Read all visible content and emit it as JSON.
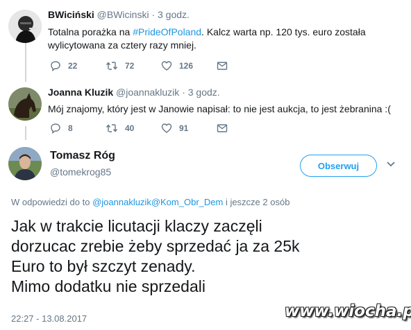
{
  "reply1": {
    "name": "BWiciński",
    "handle": "@BWicinski",
    "time": "· 3 godz.",
    "text_before": "Totalna porażka na ",
    "hashtag": "#PrideOfPoland",
    "text_after": ". Kalcz warta np. 120 tys. euro została",
    "text_line2": "wylicytowana za cztery razy mniej.",
    "replies": "22",
    "retweets": "72",
    "likes": "126"
  },
  "reply2": {
    "name": "Joanna Kluzik",
    "handle": "@joannakluzik",
    "time": "· 3 godz.",
    "text": "Mój znajomy, który jest w Janowie napisał: to nie jest aukcja, to jest żebranina :(",
    "replies": "8",
    "retweets": "40",
    "likes": "91"
  },
  "main": {
    "name": "Tomasz Róg",
    "handle": "@tomekrog85",
    "follow_label": "Obserwuj",
    "reply_prefix": "W odpowiedzi do to ",
    "reply_link": "@joannakluzik@Kom_Obr_Dem",
    "reply_suffix": " i jeszcze 2 osób",
    "text_lines": [
      "Jak w trakcie licutacji klaczy zaczęli",
      "dorzucac zrebie żeby sprzedać ja za 25k",
      "Euro to był szczyt zenady.",
      "Mimo dodatku nie sprzedali"
    ],
    "timestamp": "22:27 - 13.08.2017"
  },
  "watermark": "www.wiocha.pl",
  "colors": {
    "link": "#1b95e0",
    "muted": "#657786",
    "text": "#14171a",
    "thread_line": "#ccd6dd"
  },
  "icons": [
    "reply-icon",
    "retweet-icon",
    "like-icon",
    "message-icon",
    "chevron-down-icon"
  ]
}
